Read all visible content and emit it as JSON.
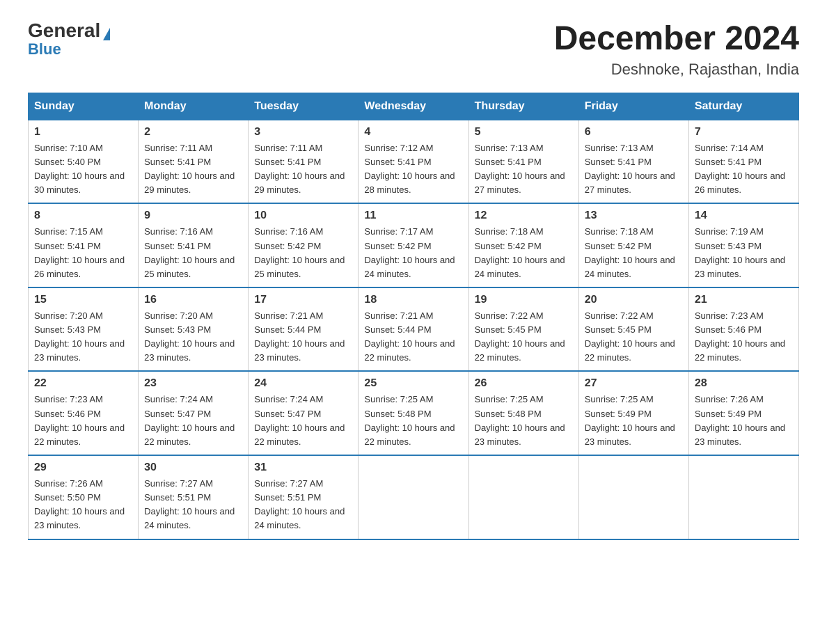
{
  "logo": {
    "general": "General",
    "blue": "Blue"
  },
  "header": {
    "month_title": "December 2024",
    "location": "Deshnoke, Rajasthan, India"
  },
  "days_of_week": [
    "Sunday",
    "Monday",
    "Tuesday",
    "Wednesday",
    "Thursday",
    "Friday",
    "Saturday"
  ],
  "weeks": [
    [
      {
        "day": "1",
        "sunrise": "7:10 AM",
        "sunset": "5:40 PM",
        "daylight": "10 hours and 30 minutes."
      },
      {
        "day": "2",
        "sunrise": "7:11 AM",
        "sunset": "5:41 PM",
        "daylight": "10 hours and 29 minutes."
      },
      {
        "day": "3",
        "sunrise": "7:11 AM",
        "sunset": "5:41 PM",
        "daylight": "10 hours and 29 minutes."
      },
      {
        "day": "4",
        "sunrise": "7:12 AM",
        "sunset": "5:41 PM",
        "daylight": "10 hours and 28 minutes."
      },
      {
        "day": "5",
        "sunrise": "7:13 AM",
        "sunset": "5:41 PM",
        "daylight": "10 hours and 27 minutes."
      },
      {
        "day": "6",
        "sunrise": "7:13 AM",
        "sunset": "5:41 PM",
        "daylight": "10 hours and 27 minutes."
      },
      {
        "day": "7",
        "sunrise": "7:14 AM",
        "sunset": "5:41 PM",
        "daylight": "10 hours and 26 minutes."
      }
    ],
    [
      {
        "day": "8",
        "sunrise": "7:15 AM",
        "sunset": "5:41 PM",
        "daylight": "10 hours and 26 minutes."
      },
      {
        "day": "9",
        "sunrise": "7:16 AM",
        "sunset": "5:41 PM",
        "daylight": "10 hours and 25 minutes."
      },
      {
        "day": "10",
        "sunrise": "7:16 AM",
        "sunset": "5:42 PM",
        "daylight": "10 hours and 25 minutes."
      },
      {
        "day": "11",
        "sunrise": "7:17 AM",
        "sunset": "5:42 PM",
        "daylight": "10 hours and 24 minutes."
      },
      {
        "day": "12",
        "sunrise": "7:18 AM",
        "sunset": "5:42 PM",
        "daylight": "10 hours and 24 minutes."
      },
      {
        "day": "13",
        "sunrise": "7:18 AM",
        "sunset": "5:42 PM",
        "daylight": "10 hours and 24 minutes."
      },
      {
        "day": "14",
        "sunrise": "7:19 AM",
        "sunset": "5:43 PM",
        "daylight": "10 hours and 23 minutes."
      }
    ],
    [
      {
        "day": "15",
        "sunrise": "7:20 AM",
        "sunset": "5:43 PM",
        "daylight": "10 hours and 23 minutes."
      },
      {
        "day": "16",
        "sunrise": "7:20 AM",
        "sunset": "5:43 PM",
        "daylight": "10 hours and 23 minutes."
      },
      {
        "day": "17",
        "sunrise": "7:21 AM",
        "sunset": "5:44 PM",
        "daylight": "10 hours and 23 minutes."
      },
      {
        "day": "18",
        "sunrise": "7:21 AM",
        "sunset": "5:44 PM",
        "daylight": "10 hours and 22 minutes."
      },
      {
        "day": "19",
        "sunrise": "7:22 AM",
        "sunset": "5:45 PM",
        "daylight": "10 hours and 22 minutes."
      },
      {
        "day": "20",
        "sunrise": "7:22 AM",
        "sunset": "5:45 PM",
        "daylight": "10 hours and 22 minutes."
      },
      {
        "day": "21",
        "sunrise": "7:23 AM",
        "sunset": "5:46 PM",
        "daylight": "10 hours and 22 minutes."
      }
    ],
    [
      {
        "day": "22",
        "sunrise": "7:23 AM",
        "sunset": "5:46 PM",
        "daylight": "10 hours and 22 minutes."
      },
      {
        "day": "23",
        "sunrise": "7:24 AM",
        "sunset": "5:47 PM",
        "daylight": "10 hours and 22 minutes."
      },
      {
        "day": "24",
        "sunrise": "7:24 AM",
        "sunset": "5:47 PM",
        "daylight": "10 hours and 22 minutes."
      },
      {
        "day": "25",
        "sunrise": "7:25 AM",
        "sunset": "5:48 PM",
        "daylight": "10 hours and 22 minutes."
      },
      {
        "day": "26",
        "sunrise": "7:25 AM",
        "sunset": "5:48 PM",
        "daylight": "10 hours and 23 minutes."
      },
      {
        "day": "27",
        "sunrise": "7:25 AM",
        "sunset": "5:49 PM",
        "daylight": "10 hours and 23 minutes."
      },
      {
        "day": "28",
        "sunrise": "7:26 AM",
        "sunset": "5:49 PM",
        "daylight": "10 hours and 23 minutes."
      }
    ],
    [
      {
        "day": "29",
        "sunrise": "7:26 AM",
        "sunset": "5:50 PM",
        "daylight": "10 hours and 23 minutes."
      },
      {
        "day": "30",
        "sunrise": "7:27 AM",
        "sunset": "5:51 PM",
        "daylight": "10 hours and 24 minutes."
      },
      {
        "day": "31",
        "sunrise": "7:27 AM",
        "sunset": "5:51 PM",
        "daylight": "10 hours and 24 minutes."
      },
      null,
      null,
      null,
      null
    ]
  ]
}
